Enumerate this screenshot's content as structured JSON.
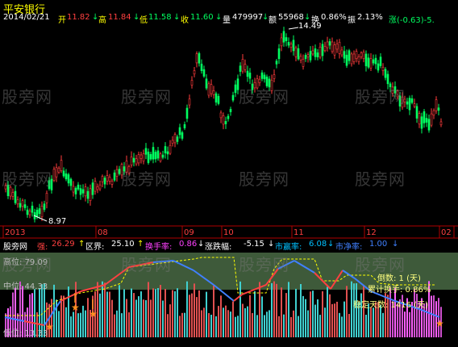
{
  "title": "平安银行",
  "info": {
    "date": "2014/02/21",
    "open_label": "开",
    "open": "11.82",
    "high_label": "高",
    "high": "11.84",
    "low_label": "低",
    "low": "11.58",
    "close_label": "收",
    "close": "11.60",
    "vol_label": "量",
    "vol": "479997",
    "amount_label": "额",
    "amount": "55968",
    "turnover_label": "换",
    "turnover": "0.86%",
    "amplitude_label": "振",
    "amplitude": "2.13%",
    "change": "涨(-0.63)-5."
  },
  "price_labels": {
    "high_mark": "14.49",
    "low_mark": "8.97"
  },
  "xaxis": {
    "y2013": "2013",
    "m08": "08",
    "m09": "09",
    "m10": "10",
    "m11": "11",
    "m12": "12",
    "m02": "02"
  },
  "indicator": {
    "name": "股旁网",
    "strong_label": "强:",
    "strong": "26.29",
    "zone_label": "区界:",
    "zone": "25.10",
    "turnover_rate_label": "换手率:",
    "turnover_rate": "0.86",
    "change_range_label": "涨跌幅:",
    "change_range": "-5.15",
    "pe_label": "市赢率:",
    "pe": "6.08",
    "pb_label": "市净率:",
    "pb": "1.00"
  },
  "panel": {
    "high_level": "高位: 79.09",
    "mid_level": "中位: 44.33",
    "low_level": "低位: 13.33",
    "reverse_days": "倒数: 1 (天)",
    "cum_turnover": "累计换手: 0.86%",
    "stable_days": "稳定天数: 1416 (天)"
  },
  "watermark": "股旁网",
  "colors": {
    "up": "#ff3c3c",
    "down": "#00ff60",
    "bg": "#000000",
    "text_yellow": "#ffff00"
  }
}
